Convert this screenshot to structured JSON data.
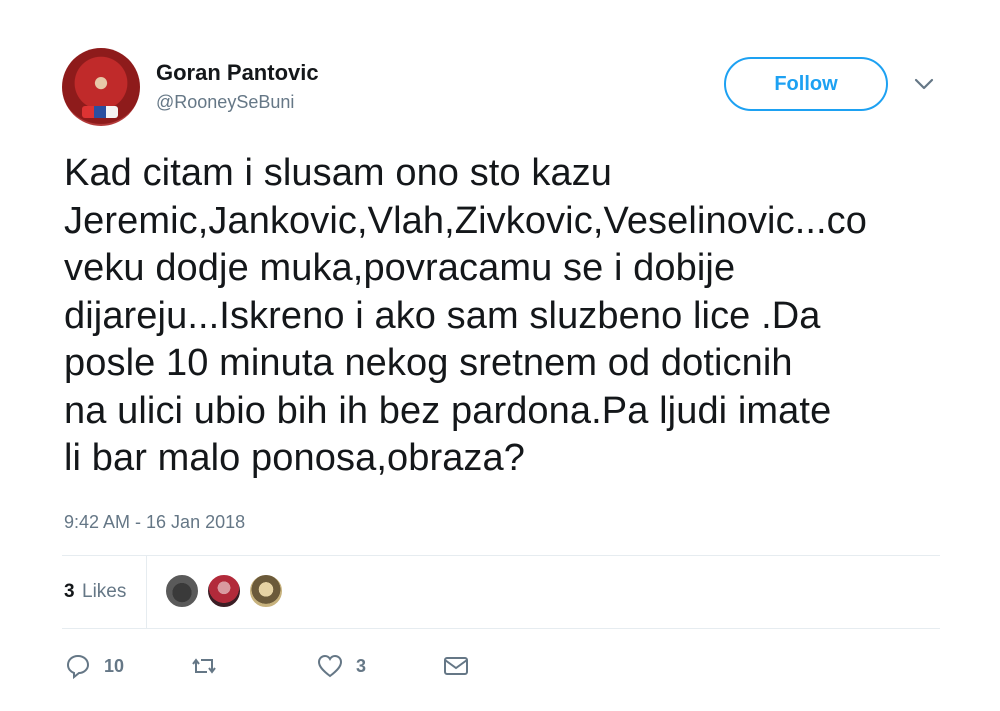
{
  "user": {
    "display_name": "Goran Pantovic",
    "handle": "@RooneySeBuni"
  },
  "follow_label": "Follow",
  "tweet": {
    "text_lines": [
      "Kad citam i slusam ono sto kazu",
      "Jeremic,Jankovic,Vlah,Zivkovic,Veselinovic...co",
      "veku dodje muka,povracamu se i dobije",
      "dijareju...Iskreno i ako sam sluzbeno lice .Da",
      "posle 10 minuta nekog sretnem od doticnih",
      "na ulici ubio bih ih bez pardona.Pa ljudi imate",
      "li bar malo ponosa,obraza?"
    ],
    "timestamp": "9:42 AM - 16 Jan 2018"
  },
  "stats": {
    "likes_count": "3",
    "likes_label": "Likes"
  },
  "actions": {
    "reply_count": "10",
    "retweet_count": "",
    "like_count": "3"
  },
  "icons": {
    "reply": "reply-icon",
    "retweet": "retweet-icon",
    "like": "heart-icon",
    "dm": "envelope-icon",
    "caret": "chevron-down-icon"
  },
  "colors": {
    "accent": "#1da1f2",
    "text": "#14171a",
    "muted": "#657786",
    "divider": "#e6ecf0"
  }
}
